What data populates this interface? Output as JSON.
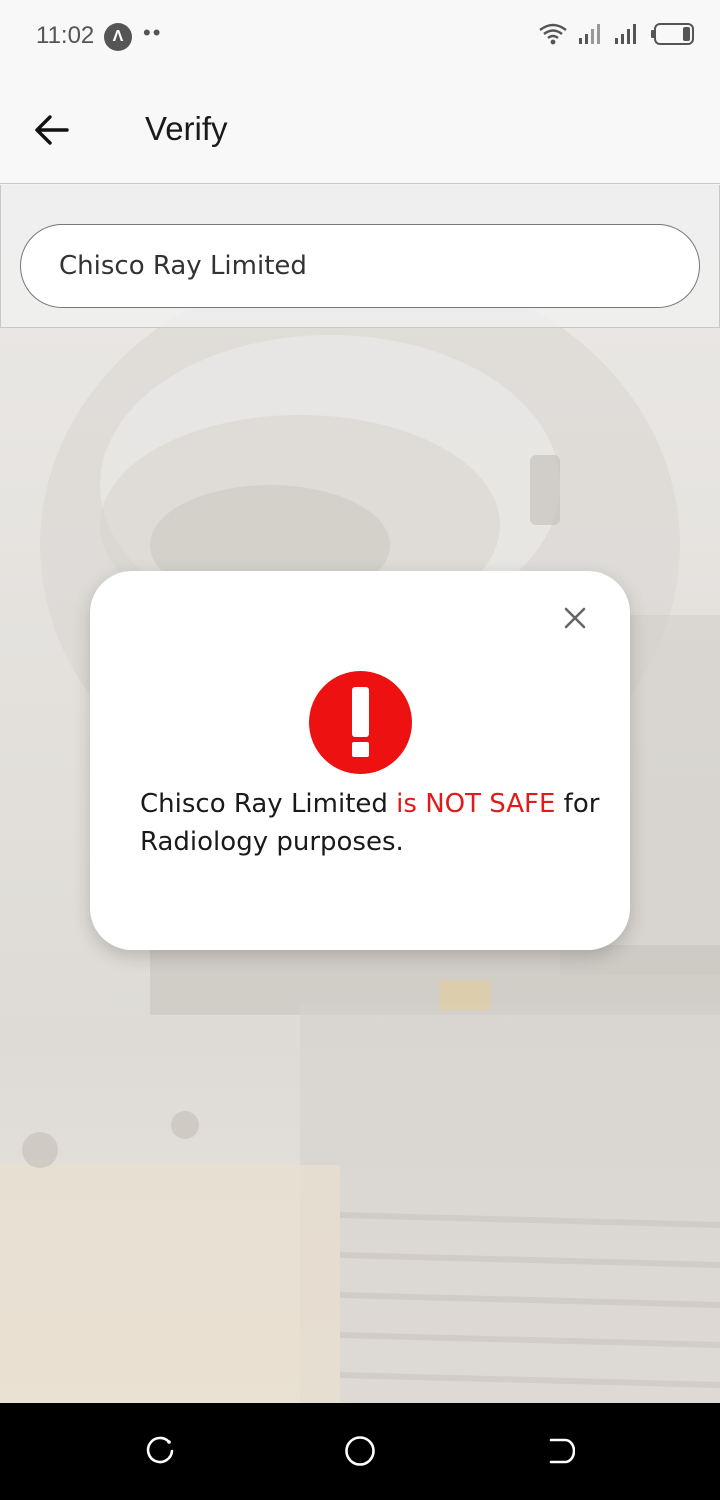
{
  "status_bar": {
    "time": "11:02",
    "app_icon": "navigation-app-icon",
    "app_icon_glyph": "Λ",
    "dots": "••",
    "icons": [
      "wifi-icon",
      "signal-icon",
      "signal-icon",
      "battery-icon"
    ]
  },
  "app_bar": {
    "title": "Verify",
    "back_icon": "arrow-left-icon"
  },
  "search": {
    "value": "Chisco Ray Limited"
  },
  "dialog": {
    "close_icon": "close-icon",
    "status_icon": "alert-icon",
    "message_prefix": "Chisco Ray Limited ",
    "message_status": "is NOT SAFE",
    "message_suffix": " for Radiology purposes.",
    "colors": {
      "danger": "#e01b1b",
      "alert_fill": "#ee1111"
    }
  },
  "nav_bar": {
    "buttons": [
      "recent-apps-icon",
      "home-icon",
      "back-icon"
    ]
  }
}
